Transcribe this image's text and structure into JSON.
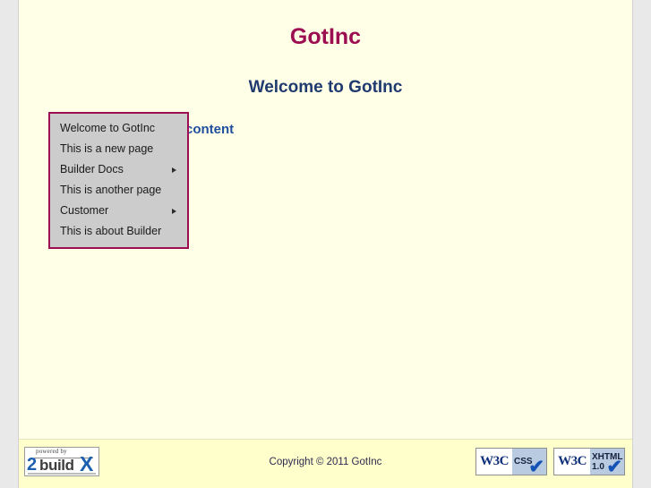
{
  "window": {
    "background_color": "#e9e9e9",
    "page_background_color": "#ffffe8"
  },
  "header": {
    "site_title": "GotInc",
    "title_color": "#9c0d51"
  },
  "main": {
    "welcome_heading": "Welcome to GotInc",
    "heading_color": "#1f3a6e",
    "content_text": "content",
    "content_text_color": "#1f4e9c"
  },
  "nav_menu": {
    "border_color": "#9c0d51",
    "background_color": "#cccccc",
    "items": [
      {
        "label": "Welcome to GotInc",
        "has_submenu": false
      },
      {
        "label": "This is a new page",
        "has_submenu": false
      },
      {
        "label": "Builder Docs",
        "has_submenu": true
      },
      {
        "label": "This is another page",
        "has_submenu": false
      },
      {
        "label": "Customer",
        "has_submenu": true
      },
      {
        "label": "This is about Builder",
        "has_submenu": false
      }
    ]
  },
  "footer": {
    "background_color": "#ffffcc",
    "copyright": "Copyright © 2011 GotInc",
    "powered_by": {
      "top_text": "powered by",
      "digit": "2",
      "word": "build",
      "letter": "X"
    },
    "badges": [
      {
        "mark": "W3C",
        "label": "CSS",
        "second_line": "",
        "check": "✔"
      },
      {
        "mark": "W3C",
        "label": "XHTML",
        "second_line": "1.0",
        "check": "✔"
      }
    ]
  }
}
